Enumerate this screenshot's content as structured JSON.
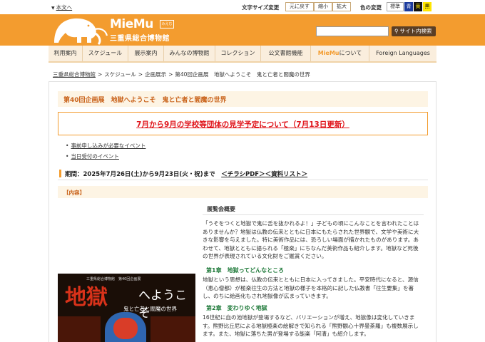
{
  "topbar": {
    "skip_label": "本文へ",
    "font_size_label": "文字サイズ変更",
    "font_size_buttons": [
      "元に戻す",
      "縮小",
      "拡大"
    ],
    "color_label": "色の変更",
    "color_buttons": [
      "標準",
      "青",
      "黄",
      "黒"
    ]
  },
  "header": {
    "logo_en": "MieMu",
    "logo_small": "みえむ",
    "logo_jp": "三重県総合博物館",
    "search_button": "サイト内検索"
  },
  "nav": {
    "items": [
      "利用案内",
      "スケジュール",
      "展示案内",
      "みんなの博物館",
      "コレクション",
      "公文書館機能"
    ],
    "about_brand": "MieMu",
    "about_suffix": "について",
    "foreign": "Foreign Languages"
  },
  "breadcrumb": {
    "home": "三重県総合博物館",
    "schedule": "スケジュール",
    "exhibit": "企画展示",
    "current": "第40回企画展　地獄へようこそ　鬼と亡者と閻魔の世界"
  },
  "page": {
    "title": "第40回企画展　地獄へようこそ　鬼と亡者と閻魔の世界",
    "notice": "7月から9月の学校等団体の見学予定について（7月13日更新）",
    "events": [
      "事前申し込みが必要なイベント",
      "当日受付のイベント"
    ],
    "period_text": "期間：2025年7月26日(土)から9月23日(火・祝)まで　",
    "flyer_link": "＜チラシPDF＞",
    "materials_link": "＜資料リスト＞",
    "section_label": "【内容】"
  },
  "poster": {
    "subtitle": "三重県総合博物館　第40回企画展",
    "title_main": "地獄",
    "title_kana": "へようこそ",
    "tagline": "鬼と亡者と閻魔の世界"
  },
  "overview": {
    "heading": "展覧会概要",
    "intro": "「うそをつくと地獄で鬼に舌を抜かれるよ！」子どもの頃にこんなことを言われたことはありませんか？地獄は仏教の伝来とともに日本にもたらされた世界観で、文学や美術に大きな影響を与えました。特に美術作品には、恐ろしい場面が描かれたものがあります。あわせて、地獄とともに語られる「極楽」にちなんだ美術作品も紹介します。地獄など死後の世界が表現されている文化財をご鑑賞ください。",
    "chapter1_title": "第1章　地獄ってどんなところ",
    "chapter1_text": "地獄という思想は、仏教の伝来とともに日本に入ってきました。平安時代になると、源信（恵心僧都）が極楽往生の方法と地獄の様子を本格的に記した仏教書「往生要集」を著し、のちに絵画化もされ地獄像が広まっていきます。",
    "chapter2_title": "第2章　変わりゆく地獄",
    "chapter2_text": "16世紀に血の池地獄が登場するなど、バリエーションが増え、地獄像は変化していきます。熊野比丘尼による地獄極楽の絵解きで知られる「熊野観心十界曼荼羅」も複数展示します。また、地獄に落ちた男が登場する能楽「阿漕」も紹介します。"
  }
}
